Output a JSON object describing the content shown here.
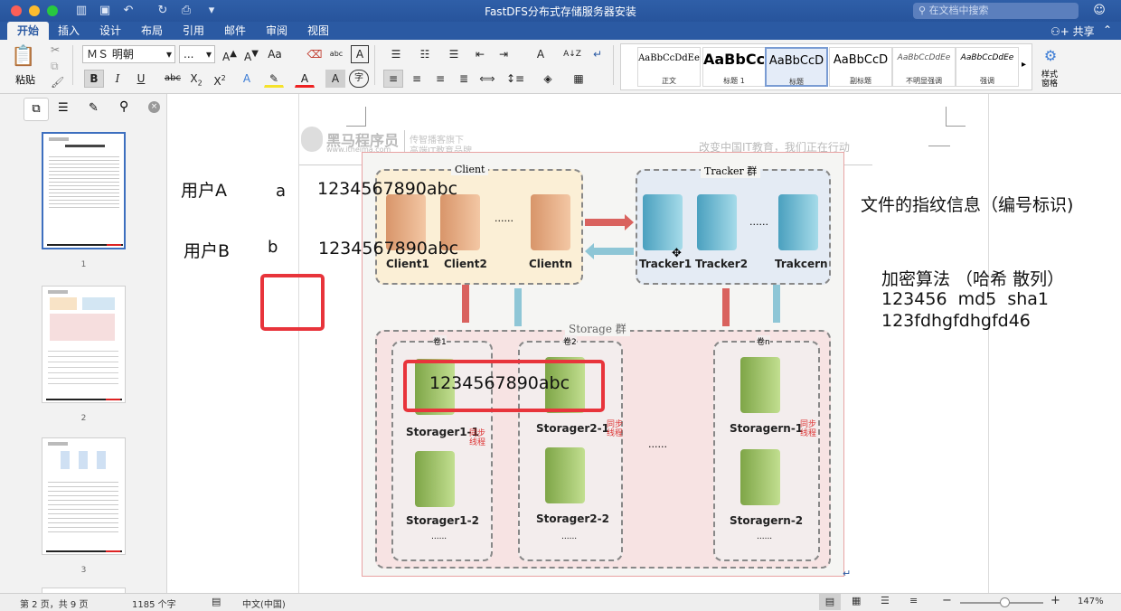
{
  "window": {
    "title": "FastDFS分布式存储服务器安装",
    "search_placeholder": "在文档中搜索",
    "share_label": "共享"
  },
  "ribbon_tabs": [
    "开始",
    "插入",
    "设计",
    "布局",
    "引用",
    "邮件",
    "审阅",
    "视图"
  ],
  "ribbon": {
    "paste_label": "粘贴",
    "font_name": "ＭＳ 明朝",
    "font_size": "...",
    "styles": [
      {
        "sample": "AaBbCcDdEe",
        "name": "正文"
      },
      {
        "sample": "AaBbCc",
        "name": "标题 1"
      },
      {
        "sample": "AaBbCcD",
        "name": "标题"
      },
      {
        "sample": "AaBbCcD",
        "name": "副标题"
      },
      {
        "sample": "AaBbCcDdEe",
        "name": "不明显强调"
      },
      {
        "sample": "AaBbCcDdEe",
        "name": "强调"
      }
    ],
    "styles_pane_label_1": "样式",
    "styles_pane_label_2": "窗格"
  },
  "thumbnails": [
    "1",
    "2",
    "3"
  ],
  "page": {
    "header_brand": "黑马程序员",
    "header_url": "www.itheima.com",
    "header_tag_1": "传智播客旗下",
    "header_tag_2": "高端IT教育品牌",
    "header_slogan": "改变中国IT教育，我们正在行动"
  },
  "diagram": {
    "client_group": "Client",
    "tracker_group": "Tracker 群",
    "storage_group": "Storage 群",
    "clients": [
      "Client1",
      "Client2",
      "Clientn"
    ],
    "client_dots": "......",
    "trackers": [
      "Tracker1",
      "Tracker2",
      "Trakcern"
    ],
    "tracker_dots": "......",
    "volumes": [
      "卷1",
      "卷2",
      "卷n"
    ],
    "storages_top": [
      "Storager1-1",
      "Storager2-1",
      "Storagern-1"
    ],
    "storages_bottom": [
      "Storager1-2",
      "Storager2-2",
      "Storagern-2"
    ],
    "sync_label": "同步\n线程",
    "vol_dots": "......",
    "mid_dots": "......"
  },
  "annotations": {
    "user_a": "用户A",
    "letter_a": "a",
    "hash_a": "1234567890abc",
    "user_b": "用户B",
    "letter_b": "b",
    "hash_b": "1234567890abc",
    "boxed_hash": "1234567890abc",
    "fingerprint": "文件的指纹信息（编号标识)",
    "encrypt_title": "加密算法 （哈希 散列）",
    "encrypt_line2": "123456  md5  sha1",
    "encrypt_line3": "123fdhgfdhgfd46"
  },
  "status": {
    "page": "第 2 页，共 9 页",
    "words": "1185 个字",
    "language": "中文(中国)",
    "zoom": "147%"
  },
  "colors": {
    "titlebar": "#2b5aa3",
    "red_box": "#e8343b"
  }
}
